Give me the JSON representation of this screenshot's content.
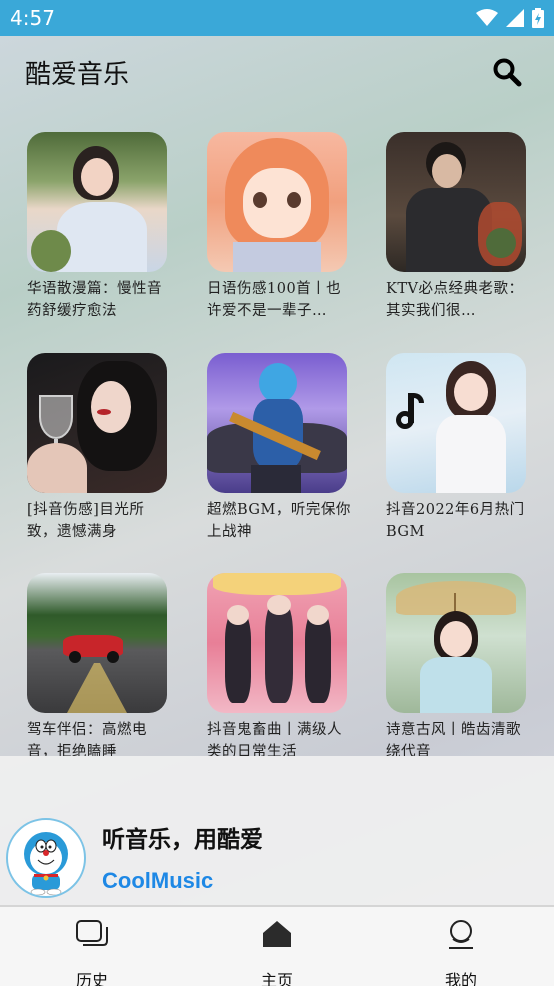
{
  "status_bar": {
    "time": "4:57",
    "icons": [
      "wifi-icon",
      "cell-signal-icon",
      "battery-icon"
    ]
  },
  "header": {
    "title": "酷爱音乐",
    "search_icon": "search-icon"
  },
  "playlists": [
    {
      "label": "华语散漫篇：慢性音药舒缓疗愈法"
    },
    {
      "label": "日语伤感100首丨也许爱不是一辈子…"
    },
    {
      "label": "KTV必点经典老歌：其实我们很…"
    },
    {
      "label": "[抖音伤感]目光所致，遗憾满身"
    },
    {
      "label": "超燃BGM，听完保你上战神"
    },
    {
      "label": "抖音2022年6月热门BGM"
    },
    {
      "label": "驾车伴侣：高燃电音，拒绝瞌睡"
    },
    {
      "label": "抖音鬼畜曲丨满级人类的日常生活"
    },
    {
      "label": "诗意古风丨皓齿清歌绕代音"
    }
  ],
  "promo": {
    "slogan": "听音乐，用酷爱",
    "brand": "CoolMusic"
  },
  "bottom_nav": {
    "history_label": "历史",
    "home_label": "主页",
    "mine_label": "我的"
  },
  "colors": {
    "status_bar": "#3aa8d8",
    "brand": "#1e88e5"
  }
}
